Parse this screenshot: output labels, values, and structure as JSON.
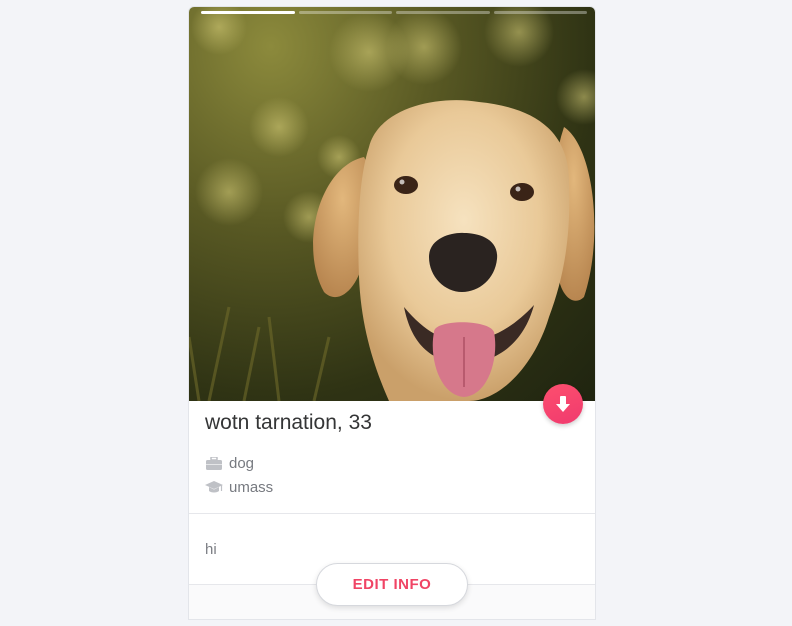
{
  "profile": {
    "name_age": "wotn tarnation, 33",
    "job": "dog",
    "school": "umass",
    "bio": "hi",
    "photo_count": 4,
    "active_photo_index": 0,
    "job_icon": "briefcase-icon",
    "school_icon": "graduation-cap-icon"
  },
  "actions": {
    "edit_label": "EDIT INFO",
    "collapse_icon": "arrow-down-icon"
  },
  "colors": {
    "accent": "#f04465",
    "text_dark": "#343536",
    "text_muted": "#777a80",
    "page_bg": "#f3f4f8"
  }
}
